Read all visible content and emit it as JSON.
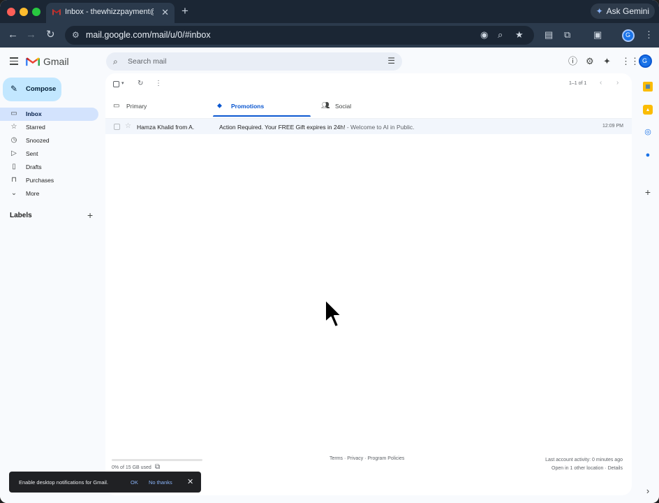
{
  "browser": {
    "tab_title": "Inbox - thewhizzpayment@gmail.com",
    "tab_close": "✕",
    "new_tab": "+",
    "ask_gemini": "Ask Gemini",
    "url": "mail.google.com/mail/u/0/#inbox",
    "profile_initial": "G"
  },
  "gmail": {
    "brand": "Gmail",
    "search_placeholder": "Search mail",
    "avatar_initial": "G",
    "compose_label": "Compose",
    "nav": [
      {
        "label": "Inbox",
        "icon": "inbox-icon"
      },
      {
        "label": "Starred",
        "icon": "star-icon"
      },
      {
        "label": "Snoozed",
        "icon": "clock-icon"
      },
      {
        "label": "Sent",
        "icon": "send-icon"
      },
      {
        "label": "Drafts",
        "icon": "draft-icon"
      },
      {
        "label": "Purchases",
        "icon": "bag-icon"
      },
      {
        "label": "More",
        "icon": "chevron-down-icon"
      }
    ],
    "labels_title": "Labels",
    "labels_add": "+",
    "pager_text": "1–1 of 1",
    "tabs": [
      {
        "label": "Primary",
        "icon": "inbox-icon"
      },
      {
        "label": "Promotions",
        "icon": "tag-icon",
        "active": true
      },
      {
        "label": "Social",
        "icon": "people-icon"
      }
    ],
    "email": {
      "sender": "Hamza Khalid from A.",
      "subject": "Action Required. Your FREE Gift expires in 24h!",
      "snippet": " - Welcome to AI in Public.",
      "time": "12:09 PM"
    },
    "storage": {
      "text": "0% of 15 GB used",
      "fraction": 0.0
    },
    "footer_links": "Terms · Privacy · Program Policies",
    "activity_line1": "Last account activity: 0 minutes ago",
    "activity_line2": "Open in 1 other location · Details",
    "toast": {
      "text": "Enable desktop notifications for Gmail.",
      "ok": "OK",
      "no_thanks": "No thanks",
      "close": "✕"
    },
    "side_add": "+",
    "side_expand": "›"
  }
}
